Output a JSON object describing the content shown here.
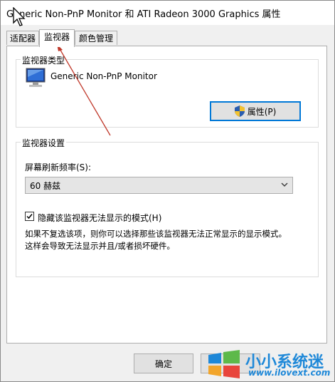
{
  "window": {
    "title": "Generic Non-PnP Monitor 和 ATI Radeon 3000 Graphics 属性"
  },
  "tabs": [
    {
      "label": "适配器",
      "active": false
    },
    {
      "label": "监视器",
      "active": true
    },
    {
      "label": "颜色管理",
      "active": false
    }
  ],
  "monitor_type": {
    "group_title": "监视器类型",
    "monitor_name": "Generic Non-PnP Monitor",
    "properties_button": "属性(P)",
    "icon": "monitor-icon"
  },
  "monitor_settings": {
    "group_title": "监视器设置",
    "refresh_label": "屏幕刷新频率(S):",
    "refresh_value": "60 赫兹",
    "hide_modes_label": "隐藏该监视器无法显示的模式(H)",
    "hide_modes_checked": true,
    "description_line1": "如果不复选该项，则你可以选择那些该监视器无法正常显示的显示模式。",
    "description_line2": "这样会导致无法显示并且/或者损坏硬件。"
  },
  "footer": {
    "ok_button": "确定"
  },
  "watermark": {
    "text_cn": "小小系统迷",
    "text_url": "www.ilovext.com"
  },
  "colors": {
    "accent": "#0078d7",
    "annotation_arrow": "#c0392b",
    "watermark": "#1e88d8"
  }
}
